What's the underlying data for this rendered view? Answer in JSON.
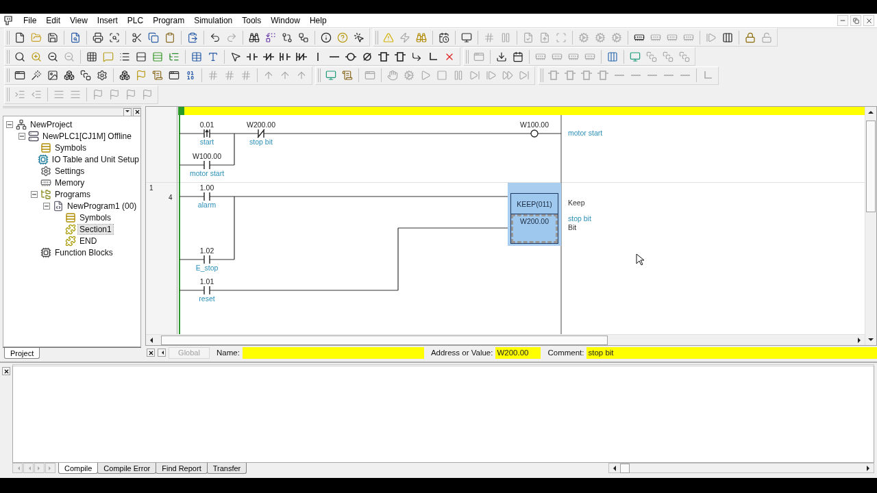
{
  "menu": [
    "File",
    "Edit",
    "View",
    "Insert",
    "PLC",
    "Program",
    "Simulation",
    "Tools",
    "Window",
    "Help"
  ],
  "toolbar_rows": [
    [
      [
        [
          {
            "kind": "new",
            "disabled": false
          },
          {
            "kind": "open",
            "disabled": false
          },
          {
            "kind": "save",
            "disabled": false
          }
        ],
        [
          {
            "kind": "preview",
            "disabled": false
          }
        ],
        [
          {
            "kind": "print",
            "disabled": false
          },
          {
            "kind": "print-preview",
            "disabled": false
          }
        ],
        [
          {
            "kind": "cut",
            "disabled": false
          },
          {
            "kind": "copy",
            "disabled": false
          },
          {
            "kind": "paste",
            "disabled": false
          }
        ],
        [
          {
            "kind": "paste-special",
            "disabled": false
          }
        ],
        [
          {
            "kind": "undo",
            "disabled": false
          },
          {
            "kind": "redo",
            "disabled": true
          }
        ],
        [
          {
            "kind": "find",
            "disabled": false
          },
          {
            "kind": "replace",
            "disabled": false
          },
          {
            "kind": "cross-ref",
            "disabled": false
          },
          {
            "kind": "address-ref",
            "disabled": false
          }
        ],
        [
          {
            "kind": "info",
            "disabled": false
          },
          {
            "kind": "help",
            "disabled": false
          },
          {
            "kind": "whats-this",
            "disabled": false
          }
        ]
      ],
      [
        [
          {
            "kind": "warning",
            "disabled": false
          },
          {
            "kind": "zap",
            "disabled": true
          },
          {
            "kind": "find-warning",
            "disabled": false
          }
        ],
        [
          {
            "kind": "calendar-warn",
            "disabled": false
          }
        ],
        [
          {
            "kind": "monitor-warn",
            "disabled": false
          }
        ],
        [
          {
            "kind": "hash",
            "disabled": true
          },
          {
            "kind": "pause",
            "disabled": true
          }
        ],
        [
          {
            "kind": "file-check",
            "disabled": true
          },
          {
            "kind": "file-up",
            "disabled": true
          },
          {
            "kind": "scan",
            "disabled": true
          }
        ],
        [
          {
            "kind": "cog",
            "disabled": true
          },
          {
            "kind": "cog",
            "disabled": true
          },
          {
            "kind": "cog",
            "disabled": true
          }
        ],
        [
          {
            "kind": "memory",
            "disabled": false
          },
          {
            "kind": "memory",
            "disabled": true
          },
          {
            "kind": "memory",
            "disabled": true
          },
          {
            "kind": "memory",
            "disabled": true
          }
        ],
        [
          {
            "kind": "step",
            "disabled": true
          },
          {
            "kind": "bars",
            "disabled": false
          }
        ],
        [
          {
            "kind": "lock",
            "disabled": false
          },
          {
            "kind": "unlock",
            "disabled": true
          }
        ]
      ]
    ],
    [
      [
        [
          {
            "kind": "zoom-small",
            "disabled": false
          },
          {
            "kind": "zoom-in",
            "disabled": false
          },
          {
            "kind": "zoom-out",
            "disabled": false
          },
          {
            "kind": "zoom-out",
            "disabled": true
          }
        ],
        [
          {
            "kind": "grid",
            "disabled": false
          },
          {
            "kind": "comments",
            "disabled": false
          },
          {
            "kind": "list",
            "disabled": false
          },
          {
            "kind": "io-comment",
            "disabled": false
          },
          {
            "kind": "rungs",
            "disabled": false
          },
          {
            "kind": "tree",
            "disabled": false
          }
        ],
        [
          {
            "kind": "table",
            "disabled": false
          },
          {
            "kind": "text",
            "disabled": false
          }
        ],
        [
          {
            "kind": "pointer",
            "disabled": false
          },
          {
            "kind": "contact",
            "disabled": false
          },
          {
            "kind": "contact-nc",
            "disabled": false
          },
          {
            "kind": "or-contact",
            "disabled": false
          },
          {
            "kind": "or-contact-nc",
            "disabled": false
          },
          {
            "kind": "vline",
            "disabled": false
          },
          {
            "kind": "hline",
            "disabled": false
          },
          {
            "kind": "coil",
            "disabled": false
          },
          {
            "kind": "coil-nc",
            "disabled": false
          },
          {
            "kind": "box",
            "disabled": false
          },
          {
            "kind": "box",
            "disabled": false
          },
          {
            "kind": "corner",
            "disabled": false
          },
          {
            "kind": "bend",
            "disabled": false
          },
          {
            "kind": "delete",
            "disabled": false
          }
        ]
      ],
      [
        [
          {
            "kind": "window",
            "disabled": true
          }
        ],
        [
          {
            "kind": "download",
            "disabled": false
          },
          {
            "kind": "calendar",
            "disabled": false
          }
        ],
        [
          {
            "kind": "memory",
            "disabled": true
          },
          {
            "kind": "memory",
            "disabled": true
          },
          {
            "kind": "memory",
            "disabled": true
          },
          {
            "kind": "memory",
            "disabled": true
          }
        ],
        [
          {
            "kind": "bars-color",
            "disabled": false
          }
        ],
        [
          {
            "kind": "monitor-green",
            "disabled": false
          },
          {
            "kind": "stack",
            "disabled": true
          },
          {
            "kind": "stack",
            "disabled": true
          },
          {
            "kind": "stack",
            "disabled": true
          }
        ]
      ]
    ],
    [
      [
        [
          {
            "kind": "window",
            "disabled": false
          },
          {
            "kind": "edit",
            "disabled": false
          },
          {
            "kind": "image",
            "disabled": false
          },
          {
            "kind": "boxes",
            "disabled": false
          },
          {
            "kind": "stack",
            "disabled": false
          },
          {
            "kind": "settings",
            "disabled": false
          }
        ],
        [
          {
            "kind": "boxes",
            "disabled": false
          },
          {
            "kind": "flag",
            "disabled": false
          },
          {
            "kind": "scroll",
            "disabled": false
          },
          {
            "kind": "window",
            "disabled": false
          },
          {
            "kind": "binary",
            "disabled": false
          }
        ],
        [
          {
            "kind": "hash",
            "disabled": true
          },
          {
            "kind": "hash",
            "disabled": true
          },
          {
            "kind": "hash",
            "disabled": true
          }
        ],
        [
          {
            "kind": "up",
            "disabled": true
          },
          {
            "kind": "up",
            "disabled": true
          },
          {
            "kind": "up",
            "disabled": true
          }
        ]
      ],
      [
        [
          {
            "kind": "monitor-green",
            "disabled": false
          },
          {
            "kind": "scroll",
            "disabled": false
          }
        ],
        [
          {
            "kind": "window",
            "disabled": true
          }
        ],
        [
          {
            "kind": "hand",
            "disabled": true
          },
          {
            "kind": "cog",
            "disabled": true
          },
          {
            "kind": "play",
            "disabled": true
          },
          {
            "kind": "stop",
            "disabled": true
          },
          {
            "kind": "pause",
            "disabled": true
          },
          {
            "kind": "end",
            "disabled": true
          },
          {
            "kind": "step",
            "disabled": true
          },
          {
            "kind": "ff",
            "disabled": true
          },
          {
            "kind": "end",
            "disabled": true
          }
        ]
      ],
      [
        [
          {
            "kind": "box",
            "disabled": true
          },
          {
            "kind": "box",
            "disabled": true
          },
          {
            "kind": "box",
            "disabled": true
          },
          {
            "kind": "box",
            "disabled": true
          },
          {
            "kind": "hline",
            "disabled": true
          },
          {
            "kind": "hline",
            "disabled": true
          },
          {
            "kind": "hline",
            "disabled": true
          },
          {
            "kind": "hline",
            "disabled": true
          },
          {
            "kind": "hline",
            "disabled": true
          }
        ],
        [
          {
            "kind": "bend",
            "disabled": true
          }
        ]
      ]
    ],
    [
      [
        [
          {
            "kind": "indent",
            "disabled": true
          },
          {
            "kind": "outdent",
            "disabled": true
          }
        ],
        [
          {
            "kind": "align",
            "disabled": true
          },
          {
            "kind": "align",
            "disabled": true
          }
        ],
        [
          {
            "kind": "flag",
            "disabled": true
          },
          {
            "kind": "flag",
            "disabled": true
          },
          {
            "kind": "flag",
            "disabled": true
          },
          {
            "kind": "flag",
            "disabled": true
          }
        ]
      ]
    ]
  ],
  "project_tree": [
    {
      "label": "NewProject",
      "kind": "project",
      "selected": false,
      "expanded": true,
      "children": [
        {
          "label": "NewPLC1[CJ1M] Offline",
          "kind": "plc",
          "selected": false,
          "expanded": true,
          "children": [
            {
              "label": "Symbols",
              "kind": "symbols",
              "selected": false
            },
            {
              "label": "IO Table and Unit Setup",
              "kind": "io",
              "selected": false
            },
            {
              "label": "Settings",
              "kind": "settings",
              "selected": false
            },
            {
              "label": "Memory",
              "kind": "memory",
              "selected": false
            },
            {
              "label": "Programs",
              "kind": "programs",
              "selected": false,
              "expanded": true,
              "children": [
                {
                  "label": "NewProgram1 (00)",
                  "kind": "program",
                  "selected": false,
                  "expanded": true,
                  "children": [
                    {
                      "label": "Symbols",
                      "kind": "symbols",
                      "selected": false
                    },
                    {
                      "label": "Section1",
                      "kind": "section",
                      "selected": true
                    },
                    {
                      "label": "END",
                      "kind": "section",
                      "selected": false
                    }
                  ]
                }
              ]
            },
            {
              "label": "Function Blocks",
              "kind": "fb",
              "selected": false
            }
          ]
        }
      ]
    }
  ],
  "project_tabs": [
    {
      "label": "Project",
      "selected": true
    }
  ],
  "ladder": {
    "rungs": [
      {
        "elements": [
          {
            "kind": "contact_rising",
            "address": "0.01",
            "comment": "start"
          },
          {
            "kind": "contact",
            "address": "W100.00",
            "comment": "motor start"
          },
          {
            "kind": "contact_nc",
            "address": "W200.00",
            "comment": "stop bit"
          },
          {
            "kind": "coil",
            "address": "W100.00"
          }
        ],
        "output_notes": [
          {
            "kind": "comment",
            "text": "motor start"
          }
        ]
      },
      {
        "number": "1",
        "step": "4",
        "elements": [
          {
            "kind": "contact",
            "address": "1.00",
            "comment": "alarm"
          },
          {
            "kind": "contact",
            "address": "1.02",
            "comment": "E_stop"
          },
          {
            "kind": "contact",
            "address": "1.01",
            "comment": "reset"
          },
          {
            "kind": "instruction",
            "mnemonic": "KEEP(011)",
            "operand": "W200.00",
            "selected": true
          }
        ],
        "output_notes": [
          {
            "kind": "label",
            "text": "Keep"
          },
          {
            "kind": "comment",
            "text": "stop bit"
          },
          {
            "kind": "label",
            "text": "Bit"
          }
        ]
      }
    ]
  },
  "info_bar": {
    "scope_tab": {
      "label": "Global",
      "disabled": true
    },
    "fields": [
      {
        "label": "Name:"
      },
      {
        "label": "Address or Value:",
        "value": "W200.00"
      },
      {
        "label": "Comment:",
        "value": "stop bit"
      }
    ]
  },
  "output_tabs": [
    {
      "label": "Compile",
      "selected": true
    },
    {
      "label": "Compile Error",
      "selected": false
    },
    {
      "label": "Find Report",
      "selected": false
    },
    {
      "label": "Transfer",
      "selected": false
    }
  ]
}
